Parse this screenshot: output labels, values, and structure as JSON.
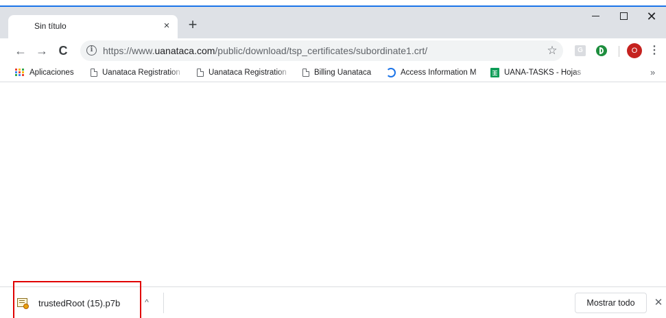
{
  "tab": {
    "title": "Sin título",
    "close_glyph": "×"
  },
  "new_tab_glyph": "+",
  "window": {
    "close_glyph": "✕"
  },
  "nav": {
    "back_glyph": "←",
    "forward_glyph": "→",
    "reload_glyph": "C"
  },
  "omnibox": {
    "info_glyph": "i",
    "url_scheme": "https://www.",
    "url_host": "uanataca.com",
    "url_path": "/public/download/tsp_certificates/subordinate1.crt/",
    "star_glyph": "☆"
  },
  "extensions": {
    "g_label": "G"
  },
  "profile": {
    "initial": "O",
    "color": "#c5221f"
  },
  "menu_glyph": "⋮",
  "bookmarks": {
    "items": [
      {
        "label": "Aplicaciones",
        "icon": "apps-icon"
      },
      {
        "label": "Uanataca Registration",
        "icon": "page-icon"
      },
      {
        "label": "Uanataca Registration",
        "icon": "page-icon"
      },
      {
        "label": "Billing Uanataca",
        "icon": "page-icon"
      },
      {
        "label": "Access Information M",
        "icon": "access-icon"
      },
      {
        "label": "UANA-TASKS - Hojas",
        "icon": "sheets-icon"
      }
    ],
    "more_glyph": "»"
  },
  "downloads": {
    "file_name": "trustedRoot (15).p7b",
    "file_icon": "certificate-icon",
    "chevron_glyph": "^",
    "show_all_label": "Mostrar todo",
    "close_glyph": "✕"
  },
  "colors": {
    "accent": "#1a73e8",
    "highlight": "#e00000"
  }
}
